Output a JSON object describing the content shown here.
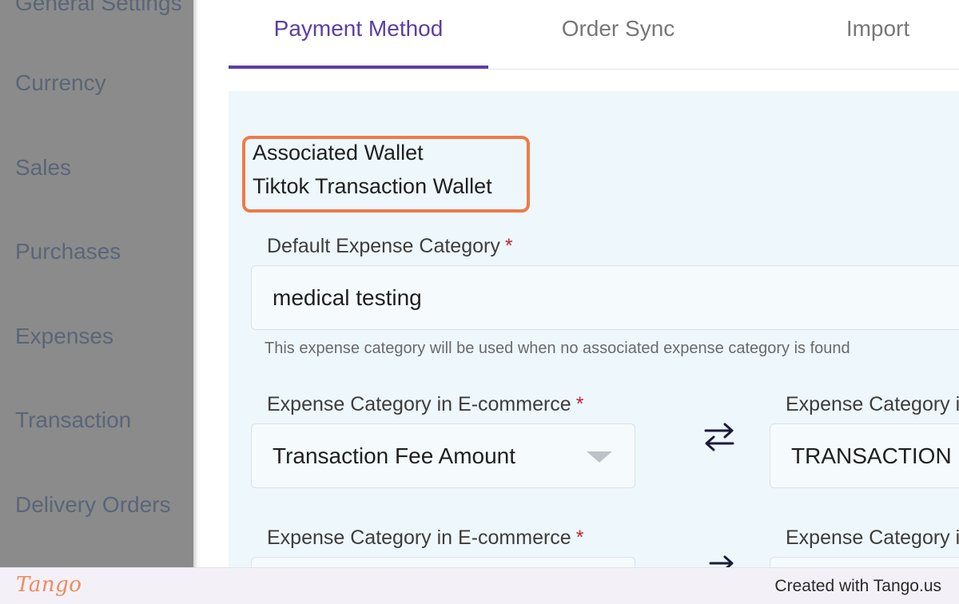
{
  "sidebar": {
    "items": [
      {
        "label": "General Settings"
      },
      {
        "label": "Currency"
      },
      {
        "label": "Sales"
      },
      {
        "label": "Purchases"
      },
      {
        "label": "Expenses"
      },
      {
        "label": "Transaction"
      },
      {
        "label": "Delivery Orders"
      }
    ]
  },
  "tabs": [
    {
      "label": "Payment Method",
      "active": true
    },
    {
      "label": "Order Sync",
      "active": false
    },
    {
      "label": "Import",
      "active": false
    }
  ],
  "wallet": {
    "title": "Associated Wallet",
    "value": "Tiktok Transaction Wallet"
  },
  "default_expense": {
    "label": "Default Expense Category",
    "required_marker": "*",
    "value": "medical testing",
    "helper": "This expense category will be used when no associated expense category is found"
  },
  "mapping_rows": [
    {
      "left_label": "Expense Category in E-commerce",
      "required_marker": "*",
      "left_value": "Transaction Fee Amount",
      "right_label": "Expense Category i",
      "right_value": "TRANSACTION F"
    },
    {
      "left_label": "Expense Category in E-commerce",
      "required_marker": "*",
      "left_value": "",
      "right_label": "Expense Category i",
      "right_value": ""
    }
  ],
  "icons": {
    "swap": "swap-arrows-icon",
    "dropdown": "chevron-down-icon"
  },
  "colors": {
    "accent": "#5b3fa5",
    "highlight": "#f07a48",
    "panel_bg": "#eef7fb",
    "required": "#c0262d"
  },
  "footer": {
    "logo": "Tango",
    "credit": "Created with Tango.us"
  }
}
